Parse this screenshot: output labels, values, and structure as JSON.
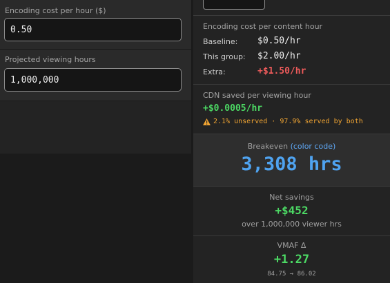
{
  "left": {
    "encoding_cost": {
      "label": "Encoding cost per hour ($)",
      "value": "0.50"
    },
    "viewing_hours": {
      "label": "Projected viewing hours",
      "value": "1,000,000"
    }
  },
  "right": {
    "encoding_per_content": {
      "title": "Encoding cost per content hour",
      "rows": [
        {
          "key": "Baseline:",
          "value": "$0.50/hr"
        },
        {
          "key": "This group:",
          "value": "$2.00/hr"
        },
        {
          "key": "Extra:",
          "value": "+$1.50/hr"
        }
      ]
    },
    "cdn": {
      "title": "CDN saved per viewing hour",
      "value": "+$0.0005/hr",
      "warning": "2.1% unserved · 97.9% served by both"
    },
    "breakeven": {
      "label": "Breakeven",
      "link": "(color code)",
      "value": "3,308 hrs"
    },
    "net_savings": {
      "label": "Net savings",
      "value": "+$452",
      "sub": "over 1,000,000 viewer hrs"
    },
    "vmaf": {
      "label": "VMAF Δ",
      "value": "+1.27",
      "sub": "84.75 → 86.02"
    }
  },
  "colors": {
    "accent_blue": "#4fa3f0",
    "positive_green": "#4cd964",
    "negative_red": "#ef5b5b",
    "warning_orange": "#f1a533"
  },
  "icons": {
    "warning": "warning-icon"
  }
}
